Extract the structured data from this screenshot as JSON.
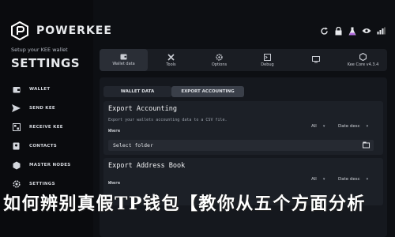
{
  "app": {
    "brand": "POWERKEE",
    "subtitle": "Setup your KEE wallet",
    "section_title": "SETTINGS"
  },
  "sidebar": {
    "items": [
      {
        "label": "WALLET",
        "icon": "wallet-icon"
      },
      {
        "label": "SEND KEE",
        "icon": "send-icon"
      },
      {
        "label": "RECEIVE KEE",
        "icon": "receive-icon"
      },
      {
        "label": "CONTACTS",
        "icon": "contacts-icon"
      },
      {
        "label": "MASTER NODES",
        "icon": "master-nodes-icon"
      },
      {
        "label": "SETTINGS",
        "icon": "settings-icon"
      }
    ]
  },
  "top_icons": [
    "refresh-icon",
    "lock-icon",
    "flask-icon",
    "eye-icon",
    "signal-icon"
  ],
  "tabs": [
    {
      "label": "Wallet data",
      "icon": "wallet-data-icon",
      "active": true
    },
    {
      "label": "Tools",
      "icon": "tools-icon"
    },
    {
      "label": "Options",
      "icon": "options-icon"
    },
    {
      "label": "Debug",
      "icon": "debug-icon"
    },
    {
      "label": "",
      "icon": "display-icon"
    },
    {
      "label": "Kee Core v4.3.4",
      "icon": "kee-core-icon"
    }
  ],
  "subtabs": {
    "wallet_data": "WALLET DATA",
    "export_accounting": "EXPORT ACCOUNTING"
  },
  "export_accounting": {
    "title": "Export Accounting",
    "description": "Export your wallets accounting data to a CSV file.",
    "where_label": "Where",
    "filter_all": "All",
    "sort": "Date desc",
    "folder_placeholder": "Select folder"
  },
  "export_address_book": {
    "title": "Export Address Book",
    "where_label": "Where",
    "filter_all": "All",
    "sort": "Date desc"
  },
  "overlay_caption": "如何辨别真假TP钱包【教你从五个方面分析"
}
